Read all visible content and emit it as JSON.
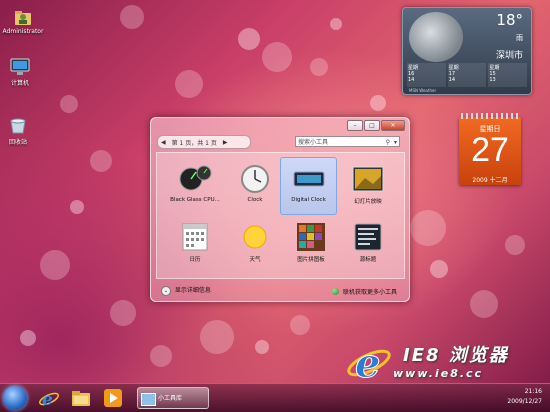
{
  "desktop": {
    "icons": [
      {
        "label": "Administrator",
        "icon": "user-folder-icon"
      },
      {
        "label": "计算机",
        "icon": "computer-icon"
      },
      {
        "label": "回收站",
        "icon": "recycle-bin-icon"
      }
    ]
  },
  "weather": {
    "temperature": "18°",
    "description": "雨",
    "city": "深圳市",
    "days": [
      {
        "name": "星期",
        "hi": "16",
        "lo": "14"
      },
      {
        "name": "星期",
        "hi": "17",
        "lo": "14"
      },
      {
        "name": "星期",
        "hi": "15",
        "lo": "13"
      }
    ],
    "source": "MSN Weather",
    "icon": "moon-weather-icon"
  },
  "calendar": {
    "weekday": "星期日",
    "day": "27",
    "month_year": "2009 十二月"
  },
  "gallery": {
    "page_label": "第 1 页，共 1 页",
    "prev": "◀",
    "next": "▶",
    "search_placeholder": "搜索小工具",
    "gadgets": [
      {
        "label": "Black Glass CPU...",
        "icon": "cpu-meter-icon",
        "selected": false
      },
      {
        "label": "Clock",
        "icon": "clock-icon",
        "selected": false
      },
      {
        "label": "Digital Clock",
        "icon": "digital-clock-icon",
        "selected": true
      },
      {
        "label": "幻灯片放映",
        "icon": "slideshow-icon",
        "selected": false
      },
      {
        "label": "日历",
        "icon": "calendar-icon",
        "selected": false
      },
      {
        "label": "天气",
        "icon": "weather-icon",
        "selected": false
      },
      {
        "label": "图片拼图板",
        "icon": "puzzle-icon",
        "selected": false
      },
      {
        "label": "源标题",
        "icon": "feed-headlines-icon",
        "selected": false
      }
    ],
    "show_details": "显示详细信息",
    "get_online": "联机获取更多小工具",
    "controls": {
      "min": "–",
      "max": "□",
      "close": "✕"
    }
  },
  "watermark": {
    "line1": "IE8 浏览器",
    "line2": "www.ie8.cc"
  },
  "taskbar": {
    "start_icon": "windows-start-orb-icon",
    "pinned": [
      {
        "icon": "internet-explorer-icon"
      },
      {
        "icon": "folder-icon"
      },
      {
        "icon": "media-player-icon"
      }
    ],
    "window_button": "小工具库",
    "time": "21:16",
    "date": "2009/12/27"
  }
}
